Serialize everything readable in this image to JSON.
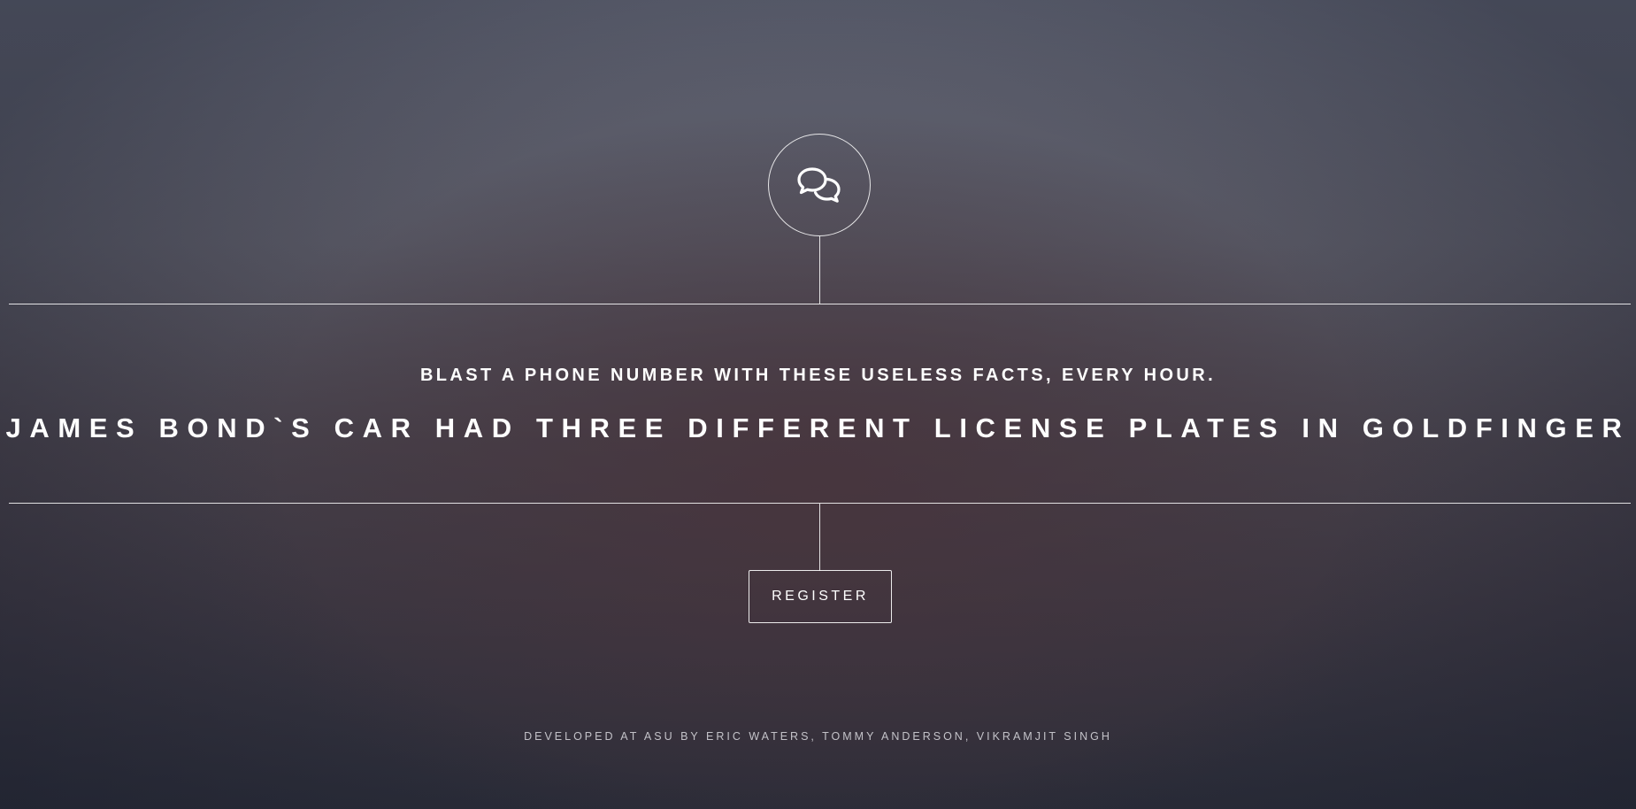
{
  "hero": {
    "icon": "chat-bubbles-icon",
    "subtitle": "BLAST A PHONE NUMBER WITH THESE USELESS FACTS, EVERY HOUR.",
    "fact": "JAMES BOND`S CAR HAD THREE DIFFERENT LICENSE PLATES IN GOLDFINGER"
  },
  "actions": {
    "register_label": "REGISTER"
  },
  "footer": {
    "credits": "DEVELOPED AT ASU BY ERIC WATERS, TOMMY ANDERSON, VIKRAMJIT SINGH"
  },
  "colors": {
    "text": "#ffffff",
    "line": "#ffffff",
    "background_top": "#5e6170",
    "background_bottom": "#2a2c38"
  }
}
